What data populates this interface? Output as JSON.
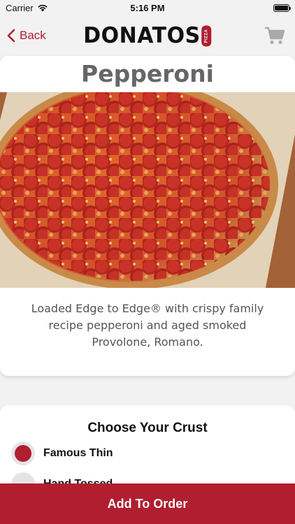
{
  "status_bar": {
    "carrier": "Carrier",
    "time": "5:16 PM",
    "battery_level": 1.0
  },
  "nav": {
    "back_label": "Back",
    "logo_text": "DONATOS",
    "logo_badge": "PIZZA",
    "cart_icon": "cart-icon"
  },
  "product": {
    "title": "Pepperoni",
    "description": "Loaded Edge to Edge® with crispy family recipe pepperoni and aged smoked Provolone, Romano."
  },
  "crust": {
    "heading": "Choose Your Crust",
    "options": [
      {
        "label": "Famous Thin",
        "selected": true
      },
      {
        "label": "Hand Tossed",
        "selected": false
      }
    ]
  },
  "footer": {
    "add_label": "Add To Order"
  },
  "colors": {
    "accent": "#b01e2f",
    "background": "#f2f2f2"
  }
}
